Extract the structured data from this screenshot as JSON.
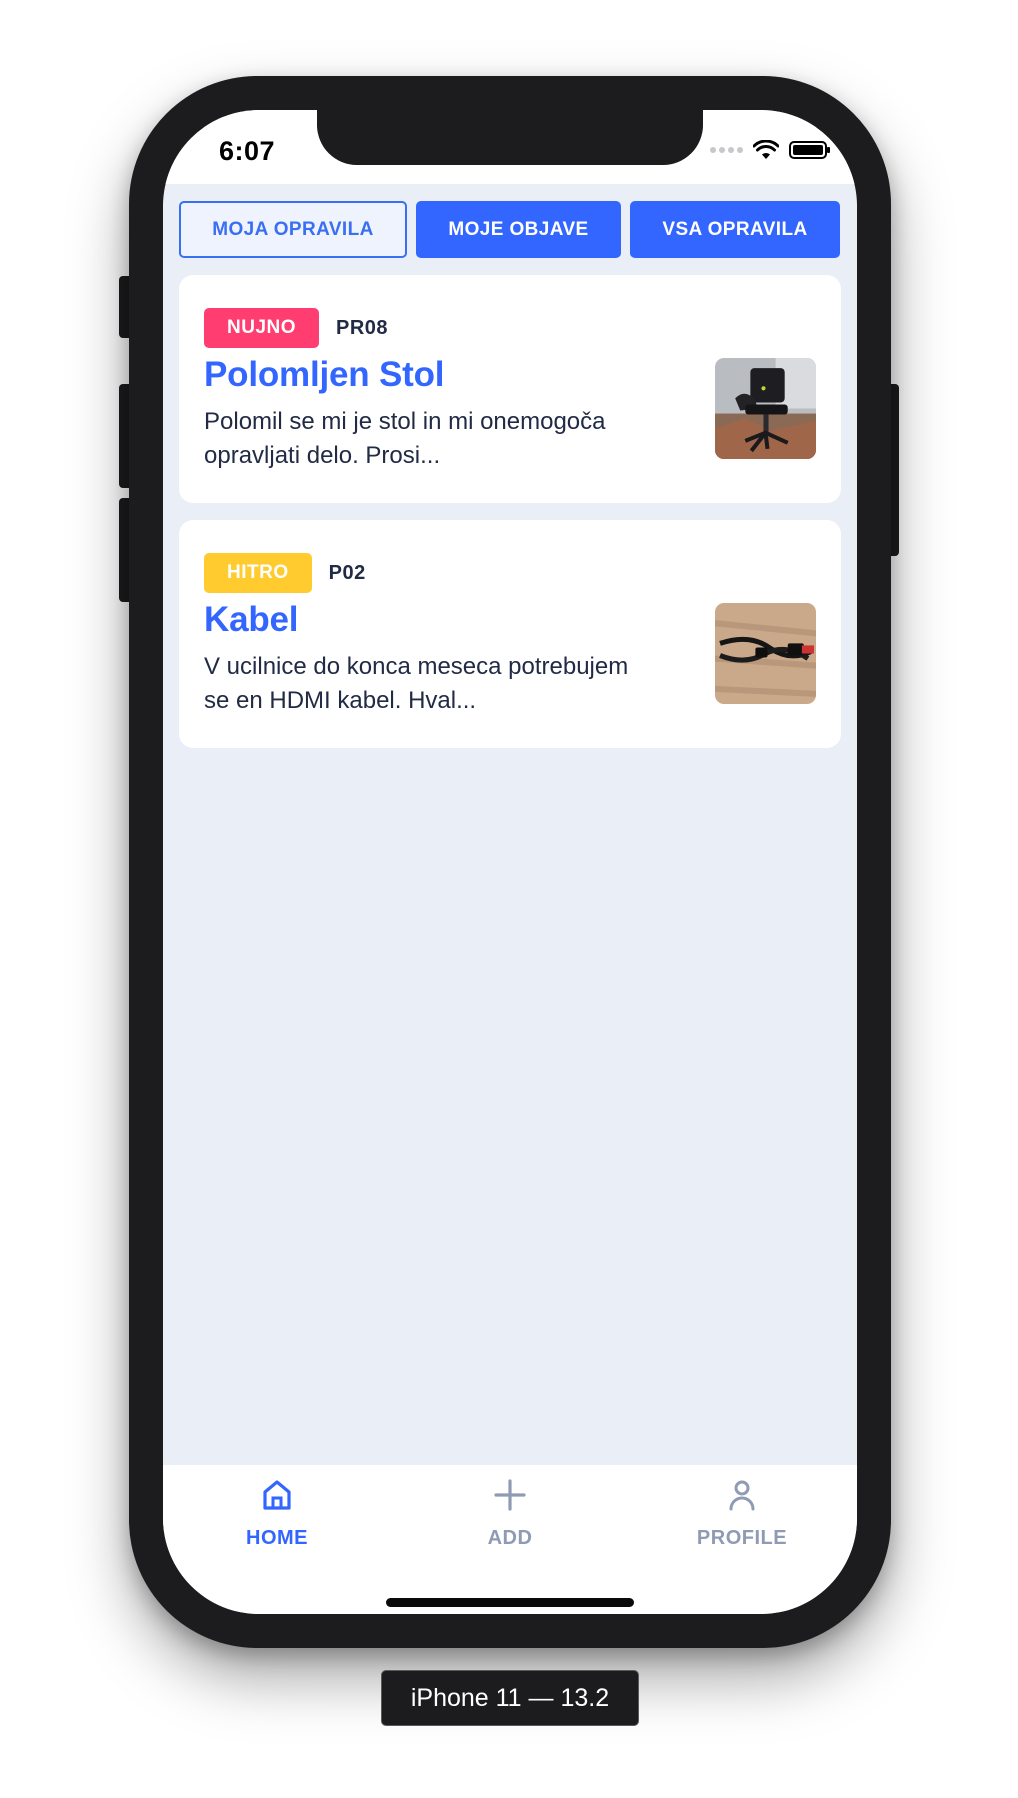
{
  "status_bar": {
    "time": "6:07",
    "icons": [
      "cellular-signal-icon",
      "wifi-icon",
      "battery-icon"
    ]
  },
  "tabs": [
    {
      "label": "MOJA OPRAVILA",
      "style": "outline"
    },
    {
      "label": "MOJE OBJAVE",
      "style": "filled"
    },
    {
      "label": "VSA OPRAVILA",
      "style": "filled"
    }
  ],
  "tasks": [
    {
      "badge": "NUJNO",
      "badge_color": "#ff3d71",
      "code": "PR08",
      "title": "Polomljen Stol",
      "description": "Polomil se mi je stol in mi onemogoča opravljati delo. Prosi...",
      "thumbnail": "office-chair-photo"
    },
    {
      "badge": "HITRO",
      "badge_color": "#ffcb2e",
      "code": "P02",
      "title": "Kabel",
      "description": "V ucilnice do konca meseca potrebujem se en HDMI kabel. Hval...",
      "thumbnail": "hdmi-cable-photo"
    }
  ],
  "bottom_nav": {
    "items": [
      {
        "label": "HOME",
        "icon": "home-icon",
        "active": true
      },
      {
        "label": "ADD",
        "icon": "plus-icon",
        "active": false
      },
      {
        "label": "PROFILE",
        "icon": "person-icon",
        "active": false
      }
    ]
  },
  "device_label": "iPhone 11 — 13.2",
  "colors": {
    "accent": "#3366ff",
    "urgent": "#ff3d71",
    "quick": "#ffcb2e",
    "text_dark": "#222b45",
    "text_muted": "#8f9bb3",
    "background": "#eaeef7"
  }
}
